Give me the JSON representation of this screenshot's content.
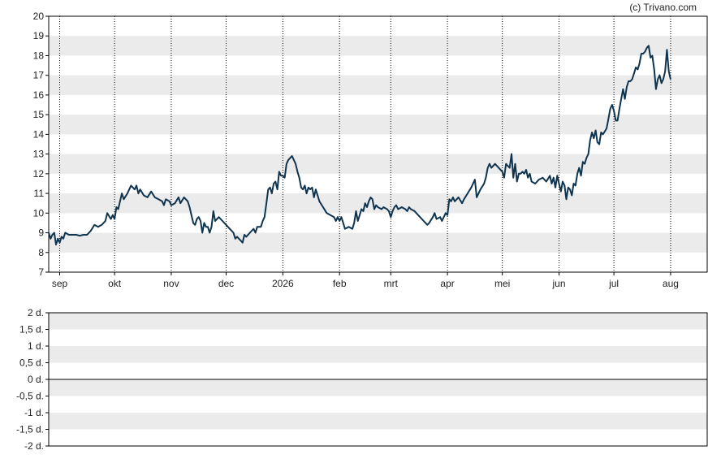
{
  "credit": "(c) Trivano.com",
  "colors": {
    "line": "#0f3450",
    "band": "#ebebeb",
    "frame": "#000000",
    "grid": "#000000",
    "text": "#222222"
  },
  "chart_data": [
    {
      "type": "line",
      "title": "",
      "xlabel": "",
      "ylabel": "",
      "ylim": [
        7,
        20
      ],
      "yticks": [
        "7",
        "8",
        "9",
        "10",
        "11",
        "12",
        "13",
        "14",
        "15",
        "16",
        "17",
        "18",
        "19",
        "20"
      ],
      "grid": "alternating horizontal bands; dotted vertical lines at month starts",
      "x_day_range": [
        0,
        360
      ],
      "month_ticks": [
        {
          "label": "sep",
          "day": 6
        },
        {
          "label": "okt",
          "day": 36
        },
        {
          "label": "nov",
          "day": 67
        },
        {
          "label": "dec",
          "day": 97
        },
        {
          "label": "2026",
          "day": 128
        },
        {
          "label": "feb",
          "day": 159
        },
        {
          "label": "mrt",
          "day": 187
        },
        {
          "label": "apr",
          "day": 218
        },
        {
          "label": "mei",
          "day": 248
        },
        {
          "label": "jun",
          "day": 279
        },
        {
          "label": "jul",
          "day": 309
        },
        {
          "label": "aug",
          "day": 340
        }
      ],
      "series": [
        {
          "points": [
            [
              0,
              9.0
            ],
            [
              1,
              8.7
            ],
            [
              2,
              8.9
            ],
            [
              3,
              9.0
            ],
            [
              4,
              8.4
            ],
            [
              5,
              8.7
            ],
            [
              6,
              8.5
            ],
            [
              7,
              8.8
            ],
            [
              8,
              8.7
            ],
            [
              9,
              9.0
            ],
            [
              11,
              8.9
            ],
            [
              13,
              8.9
            ],
            [
              15,
              8.9
            ],
            [
              17,
              8.85
            ],
            [
              19,
              8.9
            ],
            [
              21,
              8.9
            ],
            [
              23,
              9.1
            ],
            [
              25,
              9.4
            ],
            [
              27,
              9.3
            ],
            [
              29,
              9.4
            ],
            [
              31,
              9.6
            ],
            [
              32,
              10.0
            ],
            [
              34,
              9.7
            ],
            [
              35,
              9.9
            ],
            [
              36,
              9.7
            ],
            [
              37,
              10.3
            ],
            [
              38,
              10.2
            ],
            [
              40,
              11.0
            ],
            [
              41,
              10.7
            ],
            [
              43,
              11.0
            ],
            [
              45,
              11.4
            ],
            [
              47,
              11.2
            ],
            [
              48,
              11.4
            ],
            [
              49,
              11.0
            ],
            [
              50,
              11.2
            ],
            [
              52,
              10.9
            ],
            [
              54,
              10.8
            ],
            [
              56,
              11.1
            ],
            [
              58,
              10.8
            ],
            [
              60,
              10.7
            ],
            [
              62,
              10.6
            ],
            [
              63,
              10.4
            ],
            [
              64,
              10.7
            ],
            [
              66,
              10.6
            ],
            [
              67,
              10.4
            ],
            [
              69,
              10.5
            ],
            [
              71,
              10.8
            ],
            [
              72,
              10.5
            ],
            [
              74,
              10.8
            ],
            [
              76,
              10.6
            ],
            [
              77,
              10.3
            ],
            [
              79,
              9.5
            ],
            [
              80,
              9.4
            ],
            [
              81,
              9.7
            ],
            [
              82,
              9.8
            ],
            [
              83,
              9.6
            ],
            [
              84,
              9.0
            ],
            [
              85,
              9.5
            ],
            [
              86,
              9.3
            ],
            [
              87,
              9.3
            ],
            [
              88,
              9.0
            ],
            [
              89,
              9.3
            ],
            [
              90,
              10.1
            ],
            [
              91,
              9.6
            ],
            [
              92,
              9.7
            ],
            [
              93,
              9.8
            ],
            [
              95,
              9.6
            ],
            [
              97,
              9.4
            ],
            [
              99,
              9.2
            ],
            [
              101,
              9.0
            ],
            [
              102,
              8.7
            ],
            [
              103,
              8.8
            ],
            [
              105,
              8.6
            ],
            [
              106,
              8.5
            ],
            [
              107,
              8.9
            ],
            [
              108,
              8.8
            ],
            [
              110,
              9.0
            ],
            [
              112,
              9.2
            ],
            [
              113,
              9.0
            ],
            [
              114,
              9.3
            ],
            [
              116,
              9.3
            ],
            [
              117,
              9.6
            ],
            [
              118,
              9.8
            ],
            [
              119,
              10.5
            ],
            [
              120,
              11.2
            ],
            [
              121,
              11.3
            ],
            [
              122,
              11.0
            ],
            [
              123,
              11.5
            ],
            [
              124,
              11.6
            ],
            [
              125,
              11.2
            ],
            [
              126,
              12.1
            ],
            [
              127,
              11.9
            ],
            [
              128,
              11.9
            ],
            [
              129,
              11.8
            ],
            [
              130,
              12.5
            ],
            [
              131,
              12.7
            ],
            [
              133,
              12.9
            ],
            [
              135,
              12.5
            ],
            [
              136,
              12.1
            ],
            [
              137,
              11.8
            ],
            [
              138,
              11.3
            ],
            [
              139,
              11.2
            ],
            [
              140,
              11.4
            ],
            [
              141,
              11.0
            ],
            [
              142,
              11.3
            ],
            [
              143,
              11.2
            ],
            [
              144,
              11.3
            ],
            [
              145,
              10.8
            ],
            [
              146,
              11.2
            ],
            [
              148,
              10.6
            ],
            [
              150,
              10.3
            ],
            [
              152,
              10.0
            ],
            [
              154,
              9.9
            ],
            [
              156,
              9.8
            ],
            [
              157,
              9.6
            ],
            [
              158,
              9.8
            ],
            [
              159,
              9.6
            ],
            [
              160,
              9.8
            ],
            [
              161,
              9.5
            ],
            [
              162,
              9.2
            ],
            [
              164,
              9.3
            ],
            [
              166,
              9.2
            ],
            [
              167,
              9.5
            ],
            [
              168,
              10.1
            ],
            [
              169,
              9.6
            ],
            [
              170,
              9.9
            ],
            [
              171,
              10.2
            ],
            [
              172,
              10.1
            ],
            [
              173,
              10.5
            ],
            [
              174,
              10.3
            ],
            [
              175,
              10.6
            ],
            [
              176,
              10.8
            ],
            [
              177,
              10.7
            ],
            [
              178,
              10.2
            ],
            [
              179,
              10.4
            ],
            [
              180,
              10.3
            ],
            [
              182,
              10.2
            ],
            [
              183,
              10.3
            ],
            [
              185,
              10.2
            ],
            [
              186,
              10.1
            ],
            [
              187,
              9.8
            ],
            [
              188,
              10.1
            ],
            [
              189,
              10.3
            ],
            [
              190,
              10.4
            ],
            [
              191,
              10.2
            ],
            [
              193,
              10.3
            ],
            [
              195,
              10.2
            ],
            [
              196,
              10.1
            ],
            [
              197,
              10.3
            ],
            [
              198,
              10.2
            ],
            [
              200,
              10.1
            ],
            [
              201,
              10.0
            ],
            [
              203,
              9.8
            ],
            [
              205,
              9.6
            ],
            [
              207,
              9.4
            ],
            [
              208,
              9.5
            ],
            [
              210,
              9.8
            ],
            [
              211,
              10.0
            ],
            [
              212,
              9.7
            ],
            [
              214,
              9.8
            ],
            [
              215,
              9.6
            ],
            [
              217,
              10.0
            ],
            [
              218,
              9.9
            ],
            [
              219,
              10.7
            ],
            [
              220,
              10.6
            ],
            [
              221,
              10.8
            ],
            [
              222,
              10.6
            ],
            [
              224,
              10.8
            ],
            [
              226,
              10.5
            ],
            [
              227,
              10.7
            ],
            [
              229,
              11.0
            ],
            [
              231,
              11.3
            ],
            [
              233,
              11.7
            ],
            [
              234,
              10.8
            ],
            [
              236,
              11.2
            ],
            [
              238,
              11.5
            ],
            [
              239,
              11.8
            ],
            [
              240,
              12.3
            ],
            [
              241,
              12.5
            ],
            [
              242,
              12.3
            ],
            [
              244,
              12.5
            ],
            [
              246,
              12.3
            ],
            [
              248,
              12.1
            ],
            [
              249,
              11.8
            ],
            [
              250,
              12.5
            ],
            [
              251,
              12.4
            ],
            [
              252,
              12.3
            ],
            [
              253,
              13.0
            ],
            [
              254,
              11.8
            ],
            [
              255,
              12.5
            ],
            [
              256,
              11.6
            ],
            [
              257,
              12.0
            ],
            [
              258,
              12.0
            ],
            [
              259,
              12.1
            ],
            [
              260,
              12.0
            ],
            [
              261,
              12.2
            ],
            [
              262,
              11.8
            ],
            [
              263,
              12.0
            ],
            [
              264,
              11.6
            ],
            [
              266,
              11.5
            ],
            [
              268,
              11.7
            ],
            [
              270,
              11.8
            ],
            [
              272,
              11.6
            ],
            [
              274,
              11.9
            ],
            [
              275,
              11.5
            ],
            [
              276,
              11.8
            ],
            [
              277,
              11.3
            ],
            [
              278,
              11.9
            ],
            [
              279,
              11.5
            ],
            [
              280,
              11.1
            ],
            [
              281,
              11.6
            ],
            [
              282,
              11.4
            ],
            [
              283,
              10.7
            ],
            [
              284,
              11.3
            ],
            [
              285,
              11.2
            ],
            [
              286,
              10.9
            ],
            [
              287,
              11.5
            ],
            [
              288,
              11.4
            ],
            [
              289,
              12.0
            ],
            [
              290,
              12.3
            ],
            [
              291,
              11.9
            ],
            [
              292,
              12.6
            ],
            [
              293,
              12.5
            ],
            [
              294,
              12.8
            ],
            [
              295,
              13.0
            ],
            [
              296,
              13.7
            ],
            [
              297,
              14.1
            ],
            [
              298,
              13.8
            ],
            [
              299,
              14.2
            ],
            [
              300,
              13.6
            ],
            [
              301,
              13.5
            ],
            [
              302,
              14.1
            ],
            [
              303,
              14.0
            ],
            [
              305,
              14.3
            ],
            [
              306,
              14.8
            ],
            [
              307,
              15.3
            ],
            [
              308,
              15.5
            ],
            [
              309,
              15.2
            ],
            [
              310,
              14.7
            ],
            [
              311,
              14.7
            ],
            [
              312,
              15.3
            ],
            [
              313,
              15.8
            ],
            [
              314,
              16.3
            ],
            [
              315,
              15.8
            ],
            [
              316,
              16.4
            ],
            [
              317,
              16.7
            ],
            [
              318,
              16.7
            ],
            [
              319,
              16.8
            ],
            [
              320,
              17.1
            ],
            [
              321,
              17.4
            ],
            [
              322,
              17.3
            ],
            [
              323,
              17.6
            ],
            [
              324,
              18.1
            ],
            [
              325,
              18.1
            ],
            [
              326,
              18.2
            ],
            [
              327,
              18.4
            ],
            [
              328,
              18.5
            ],
            [
              329,
              17.9
            ],
            [
              330,
              18.0
            ],
            [
              331,
              17.3
            ],
            [
              332,
              16.3
            ],
            [
              333,
              16.8
            ],
            [
              334,
              17.0
            ],
            [
              335,
              16.6
            ],
            [
              336,
              16.8
            ],
            [
              337,
              17.2
            ],
            [
              338,
              18.3
            ],
            [
              339,
              17.2
            ],
            [
              340,
              16.8
            ]
          ]
        }
      ]
    },
    {
      "type": "line",
      "title": "",
      "ylim": [
        -2,
        2
      ],
      "yticks": [
        "-2 d.",
        "-1,5 d.",
        "-1 d.",
        "-0,5 d.",
        "0 d.",
        "0,5 d.",
        "1 d.",
        "1,5 d.",
        "2 d."
      ],
      "series": []
    }
  ]
}
